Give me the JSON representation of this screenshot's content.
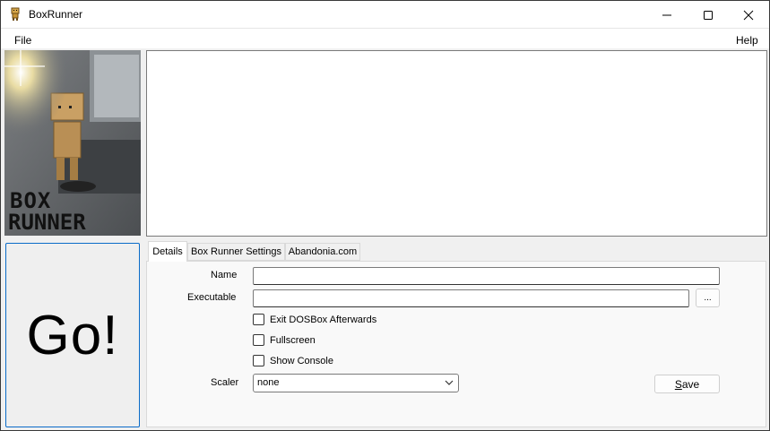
{
  "window": {
    "title": "BoxRunner",
    "icon": "boxrunner-app-icon"
  },
  "menu": {
    "file": "File",
    "help": "Help"
  },
  "logo": {
    "text": "BOX RUNNER"
  },
  "go_button": {
    "label": "Go!"
  },
  "tabs": [
    {
      "label": "Details",
      "active": true
    },
    {
      "label": "Box Runner Settings",
      "active": false
    },
    {
      "label": "Abandonia.com",
      "active": false
    }
  ],
  "details": {
    "name_label": "Name",
    "name_value": "",
    "executable_label": "Executable",
    "executable_value": "",
    "browse_label": "...",
    "checkboxes": [
      {
        "label": "Exit DOSBox Afterwards",
        "checked": false
      },
      {
        "label": "Fullscreen",
        "checked": false
      },
      {
        "label": "Show Console",
        "checked": false
      }
    ],
    "scaler_label": "Scaler",
    "scaler_value": "none",
    "save_label_first": "S",
    "save_label_rest": "ave"
  }
}
